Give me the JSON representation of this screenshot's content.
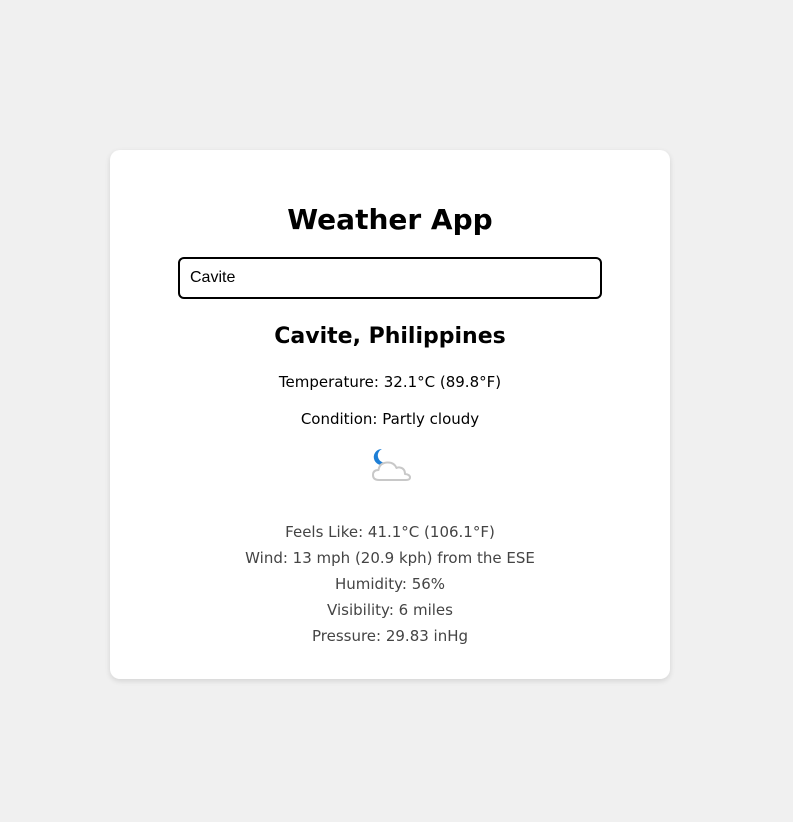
{
  "app": {
    "title": "Weather App"
  },
  "search": {
    "value": "Cavite"
  },
  "weather": {
    "location": "Cavite, Philippines",
    "temperature": "Temperature: 32.1°C (89.8°F)",
    "condition": "Condition: Partly cloudy",
    "icon": "partly-cloudy-night-icon",
    "details": {
      "feels_like": "Feels Like: 41.1°C (106.1°F)",
      "wind": "Wind: 13 mph (20.9 kph) from the ESE",
      "humidity": "Humidity: 56%",
      "visibility": "Visibility: 6 miles",
      "pressure": "Pressure: 29.83 inHg"
    }
  },
  "colors": {
    "page_background": "#f0f0f0",
    "card_background": "#ffffff",
    "moon": "#1e7fd6",
    "cloud": "#c8c8c8"
  }
}
